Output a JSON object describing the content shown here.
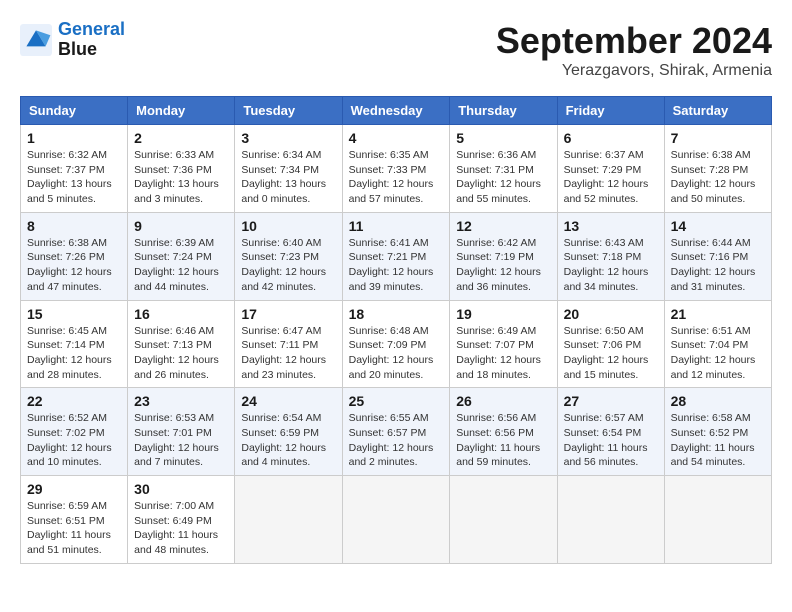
{
  "logo": {
    "line1": "General",
    "line2": "Blue"
  },
  "title": "September 2024",
  "subtitle": "Yerazgavors, Shirak, Armenia",
  "days_of_week": [
    "Sunday",
    "Monday",
    "Tuesday",
    "Wednesday",
    "Thursday",
    "Friday",
    "Saturday"
  ],
  "weeks": [
    [
      {
        "day": "1",
        "info": "Sunrise: 6:32 AM\nSunset: 7:37 PM\nDaylight: 13 hours and 5 minutes."
      },
      {
        "day": "2",
        "info": "Sunrise: 6:33 AM\nSunset: 7:36 PM\nDaylight: 13 hours and 3 minutes."
      },
      {
        "day": "3",
        "info": "Sunrise: 6:34 AM\nSunset: 7:34 PM\nDaylight: 13 hours and 0 minutes."
      },
      {
        "day": "4",
        "info": "Sunrise: 6:35 AM\nSunset: 7:33 PM\nDaylight: 12 hours and 57 minutes."
      },
      {
        "day": "5",
        "info": "Sunrise: 6:36 AM\nSunset: 7:31 PM\nDaylight: 12 hours and 55 minutes."
      },
      {
        "day": "6",
        "info": "Sunrise: 6:37 AM\nSunset: 7:29 PM\nDaylight: 12 hours and 52 minutes."
      },
      {
        "day": "7",
        "info": "Sunrise: 6:38 AM\nSunset: 7:28 PM\nDaylight: 12 hours and 50 minutes."
      }
    ],
    [
      {
        "day": "8",
        "info": "Sunrise: 6:38 AM\nSunset: 7:26 PM\nDaylight: 12 hours and 47 minutes."
      },
      {
        "day": "9",
        "info": "Sunrise: 6:39 AM\nSunset: 7:24 PM\nDaylight: 12 hours and 44 minutes."
      },
      {
        "day": "10",
        "info": "Sunrise: 6:40 AM\nSunset: 7:23 PM\nDaylight: 12 hours and 42 minutes."
      },
      {
        "day": "11",
        "info": "Sunrise: 6:41 AM\nSunset: 7:21 PM\nDaylight: 12 hours and 39 minutes."
      },
      {
        "day": "12",
        "info": "Sunrise: 6:42 AM\nSunset: 7:19 PM\nDaylight: 12 hours and 36 minutes."
      },
      {
        "day": "13",
        "info": "Sunrise: 6:43 AM\nSunset: 7:18 PM\nDaylight: 12 hours and 34 minutes."
      },
      {
        "day": "14",
        "info": "Sunrise: 6:44 AM\nSunset: 7:16 PM\nDaylight: 12 hours and 31 minutes."
      }
    ],
    [
      {
        "day": "15",
        "info": "Sunrise: 6:45 AM\nSunset: 7:14 PM\nDaylight: 12 hours and 28 minutes."
      },
      {
        "day": "16",
        "info": "Sunrise: 6:46 AM\nSunset: 7:13 PM\nDaylight: 12 hours and 26 minutes."
      },
      {
        "day": "17",
        "info": "Sunrise: 6:47 AM\nSunset: 7:11 PM\nDaylight: 12 hours and 23 minutes."
      },
      {
        "day": "18",
        "info": "Sunrise: 6:48 AM\nSunset: 7:09 PM\nDaylight: 12 hours and 20 minutes."
      },
      {
        "day": "19",
        "info": "Sunrise: 6:49 AM\nSunset: 7:07 PM\nDaylight: 12 hours and 18 minutes."
      },
      {
        "day": "20",
        "info": "Sunrise: 6:50 AM\nSunset: 7:06 PM\nDaylight: 12 hours and 15 minutes."
      },
      {
        "day": "21",
        "info": "Sunrise: 6:51 AM\nSunset: 7:04 PM\nDaylight: 12 hours and 12 minutes."
      }
    ],
    [
      {
        "day": "22",
        "info": "Sunrise: 6:52 AM\nSunset: 7:02 PM\nDaylight: 12 hours and 10 minutes."
      },
      {
        "day": "23",
        "info": "Sunrise: 6:53 AM\nSunset: 7:01 PM\nDaylight: 12 hours and 7 minutes."
      },
      {
        "day": "24",
        "info": "Sunrise: 6:54 AM\nSunset: 6:59 PM\nDaylight: 12 hours and 4 minutes."
      },
      {
        "day": "25",
        "info": "Sunrise: 6:55 AM\nSunset: 6:57 PM\nDaylight: 12 hours and 2 minutes."
      },
      {
        "day": "26",
        "info": "Sunrise: 6:56 AM\nSunset: 6:56 PM\nDaylight: 11 hours and 59 minutes."
      },
      {
        "day": "27",
        "info": "Sunrise: 6:57 AM\nSunset: 6:54 PM\nDaylight: 11 hours and 56 minutes."
      },
      {
        "day": "28",
        "info": "Sunrise: 6:58 AM\nSunset: 6:52 PM\nDaylight: 11 hours and 54 minutes."
      }
    ],
    [
      {
        "day": "29",
        "info": "Sunrise: 6:59 AM\nSunset: 6:51 PM\nDaylight: 11 hours and 51 minutes."
      },
      {
        "day": "30",
        "info": "Sunrise: 7:00 AM\nSunset: 6:49 PM\nDaylight: 11 hours and 48 minutes."
      },
      {
        "day": "",
        "info": ""
      },
      {
        "day": "",
        "info": ""
      },
      {
        "day": "",
        "info": ""
      },
      {
        "day": "",
        "info": ""
      },
      {
        "day": "",
        "info": ""
      }
    ]
  ]
}
